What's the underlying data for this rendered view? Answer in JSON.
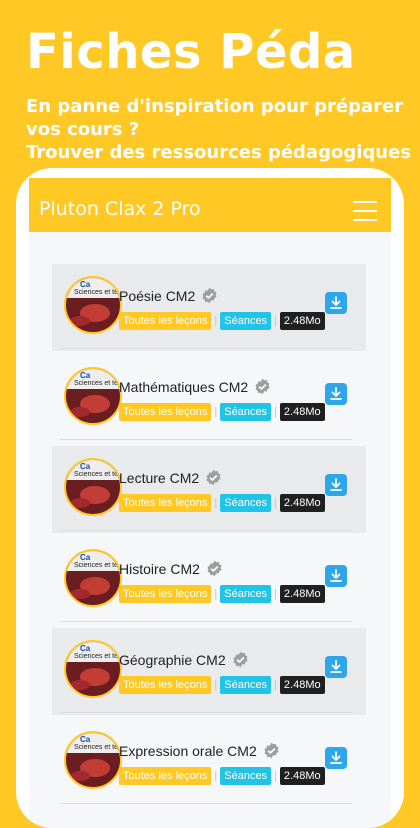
{
  "hero": {
    "title": "Fiches Péda",
    "line1": "En panne d'inspiration pour préparer",
    "line2": "vos cours ?",
    "line3": "Trouver des ressources pédagogiques"
  },
  "app": {
    "title": "Pluton Clax 2 Pro"
  },
  "thumb": {
    "line1": "Ca",
    "line2": "Sciences et technologie"
  },
  "colors": {
    "accent": "#FFC824",
    "tag_cyan": "#21c3e6",
    "tag_dark": "#202020",
    "download": "#2ea6ea"
  },
  "items": [
    {
      "title": "Poésie CM2",
      "tag1": "Toutes les leçons",
      "tag2": "Séances",
      "size": "2.48Mo"
    },
    {
      "title": "Mathématiques CM2",
      "tag1": "Toutes les leçons",
      "tag2": "Séances",
      "size": "2.48Mo"
    },
    {
      "title": "Lecture CM2",
      "tag1": "Toutes les leçons",
      "tag2": "Séances",
      "size": "2.48Mo"
    },
    {
      "title": "Histoire CM2",
      "tag1": "Toutes les leçons",
      "tag2": "Séances",
      "size": "2.48Mo"
    },
    {
      "title": "Géographie CM2",
      "tag1": "Toutes les leçons",
      "tag2": "Séances",
      "size": "2.48Mo"
    },
    {
      "title": "Expression orale CM2",
      "tag1": "Toutes les leçons",
      "tag2": "Séances",
      "size": "2.48Mo"
    }
  ]
}
